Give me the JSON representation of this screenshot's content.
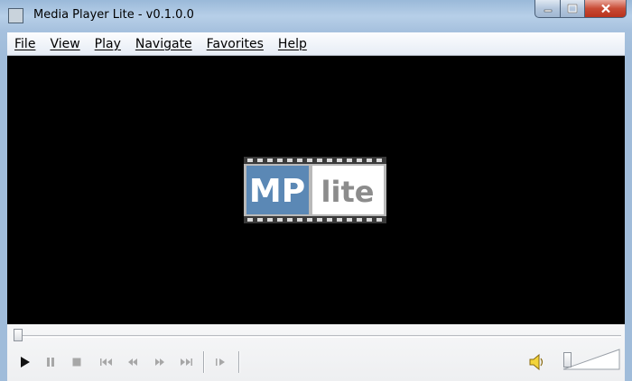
{
  "window": {
    "title": "Media Player Lite - v0.1.0.0",
    "icon": "app-icon",
    "caption_buttons": [
      "minimize-icon",
      "maximize-icon",
      "close-icon"
    ]
  },
  "menu": {
    "items": [
      {
        "label": "File"
      },
      {
        "label": "View"
      },
      {
        "label": "Play"
      },
      {
        "label": "Navigate"
      },
      {
        "label": "Favorites"
      },
      {
        "label": "Help"
      }
    ]
  },
  "video": {
    "logo_part1": "MP",
    "logo_part2": "lite",
    "colors": {
      "background": "#000000",
      "logo_blue": "#5b88b5"
    }
  },
  "controls": {
    "seek_position": 0,
    "buttons": [
      "play-icon",
      "pause-icon",
      "stop-icon",
      "previous-icon",
      "rewind-icon",
      "fast-forward-icon",
      "next-icon",
      "frame-step-icon"
    ],
    "volume_icon": "speaker-icon"
  }
}
